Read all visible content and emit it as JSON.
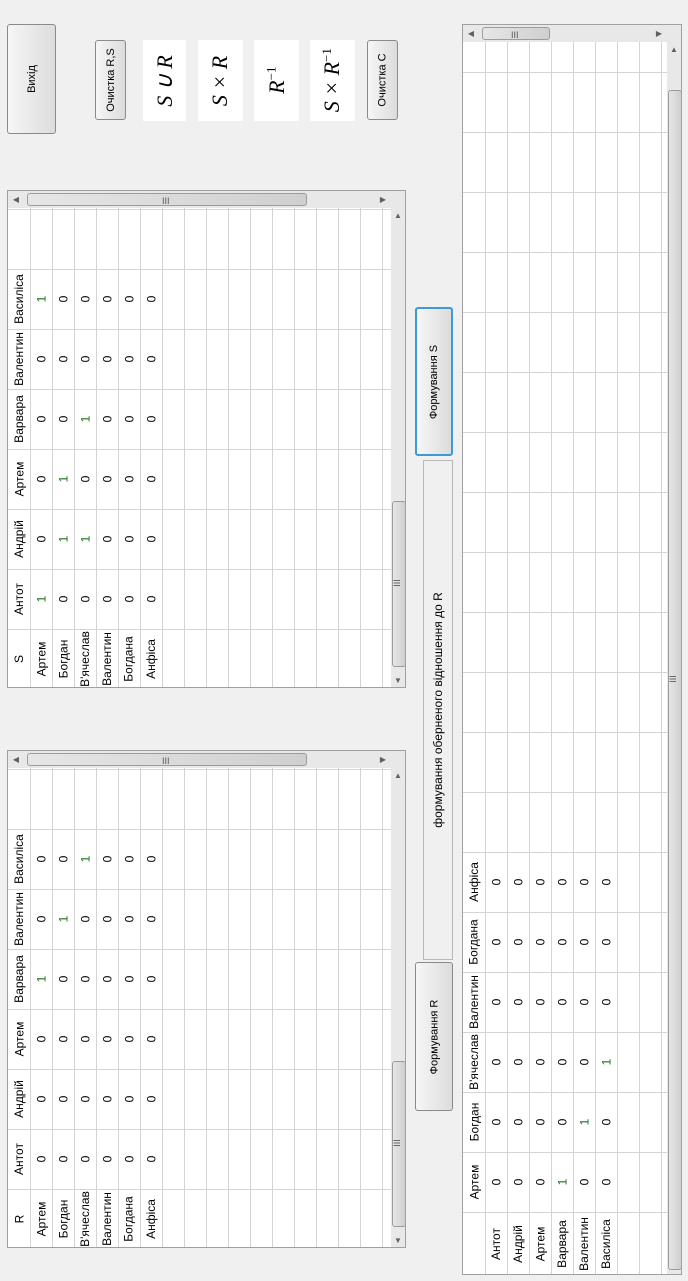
{
  "buttons": {
    "exit": "Вихід",
    "clear_rs": "Очистка R,S",
    "clear_c": "Очистка C",
    "form_s": "Формування S",
    "form_r": "Формування R"
  },
  "formulas": {
    "union": "S ∪ R",
    "product": "S × R",
    "inverse_base": "R",
    "inverse_sup": "−1",
    "product_inverse_base": "S × R",
    "product_inverse_sup": "−1"
  },
  "caption": "формування оберненого відношення до R",
  "table_s": {
    "corner": "S",
    "columns": [
      "Антот",
      "Андрій",
      "Артем",
      "Варвара",
      "Валентин",
      "Василіса"
    ],
    "rows": [
      {
        "label": "Артем",
        "values": [
          "1",
          "0",
          "0",
          "0",
          "0",
          "1"
        ]
      },
      {
        "label": "Богдан",
        "values": [
          "0",
          "1",
          "1",
          "0",
          "0",
          "0"
        ]
      },
      {
        "label": "В'ячеслав",
        "values": [
          "0",
          "1",
          "0",
          "1",
          "0",
          "0"
        ]
      },
      {
        "label": "Валентин",
        "values": [
          "0",
          "0",
          "0",
          "0",
          "0",
          "0"
        ]
      },
      {
        "label": "Богдана",
        "values": [
          "0",
          "0",
          "0",
          "0",
          "0",
          "0"
        ]
      },
      {
        "label": "Анфіса",
        "values": [
          "0",
          "0",
          "0",
          "0",
          "0",
          "0"
        ]
      }
    ]
  },
  "table_r": {
    "corner": "R",
    "columns": [
      "Антот",
      "Андрій",
      "Артем",
      "Варвара",
      "Валентин",
      "Василіса"
    ],
    "rows": [
      {
        "label": "Артем",
        "values": [
          "0",
          "0",
          "0",
          "1",
          "0",
          "0"
        ]
      },
      {
        "label": "Богдан",
        "values": [
          "0",
          "0",
          "0",
          "0",
          "1",
          "0"
        ]
      },
      {
        "label": "В'ячеслав",
        "values": [
          "0",
          "0",
          "0",
          "0",
          "0",
          "1"
        ]
      },
      {
        "label": "Валентин",
        "values": [
          "0",
          "0",
          "0",
          "0",
          "0",
          "0"
        ]
      },
      {
        "label": "Богдана",
        "values": [
          "0",
          "0",
          "0",
          "0",
          "0",
          "0"
        ]
      },
      {
        "label": "Анфіса",
        "values": [
          "0",
          "0",
          "0",
          "0",
          "0",
          "0"
        ]
      }
    ]
  },
  "table_c": {
    "corner": "",
    "columns": [
      "Артем",
      "Богдан",
      "В'ячеслав",
      "Валентин",
      "Богдана",
      "Анфіса"
    ],
    "rows": [
      {
        "label": "Антот",
        "values": [
          "0",
          "0",
          "0",
          "0",
          "0",
          "0"
        ]
      },
      {
        "label": "Андрій",
        "values": [
          "0",
          "0",
          "0",
          "0",
          "0",
          "0"
        ]
      },
      {
        "label": "Артем",
        "values": [
          "0",
          "0",
          "0",
          "0",
          "0",
          "0"
        ]
      },
      {
        "label": "Варвара",
        "values": [
          "1",
          "0",
          "0",
          "0",
          "0",
          "0"
        ]
      },
      {
        "label": "Валентин",
        "values": [
          "0",
          "1",
          "0",
          "0",
          "0",
          "0"
        ]
      },
      {
        "label": "Василіса",
        "values": [
          "0",
          "0",
          "1",
          "0",
          "0",
          "0"
        ]
      }
    ]
  },
  "scrollbar": {
    "grip": "III"
  }
}
